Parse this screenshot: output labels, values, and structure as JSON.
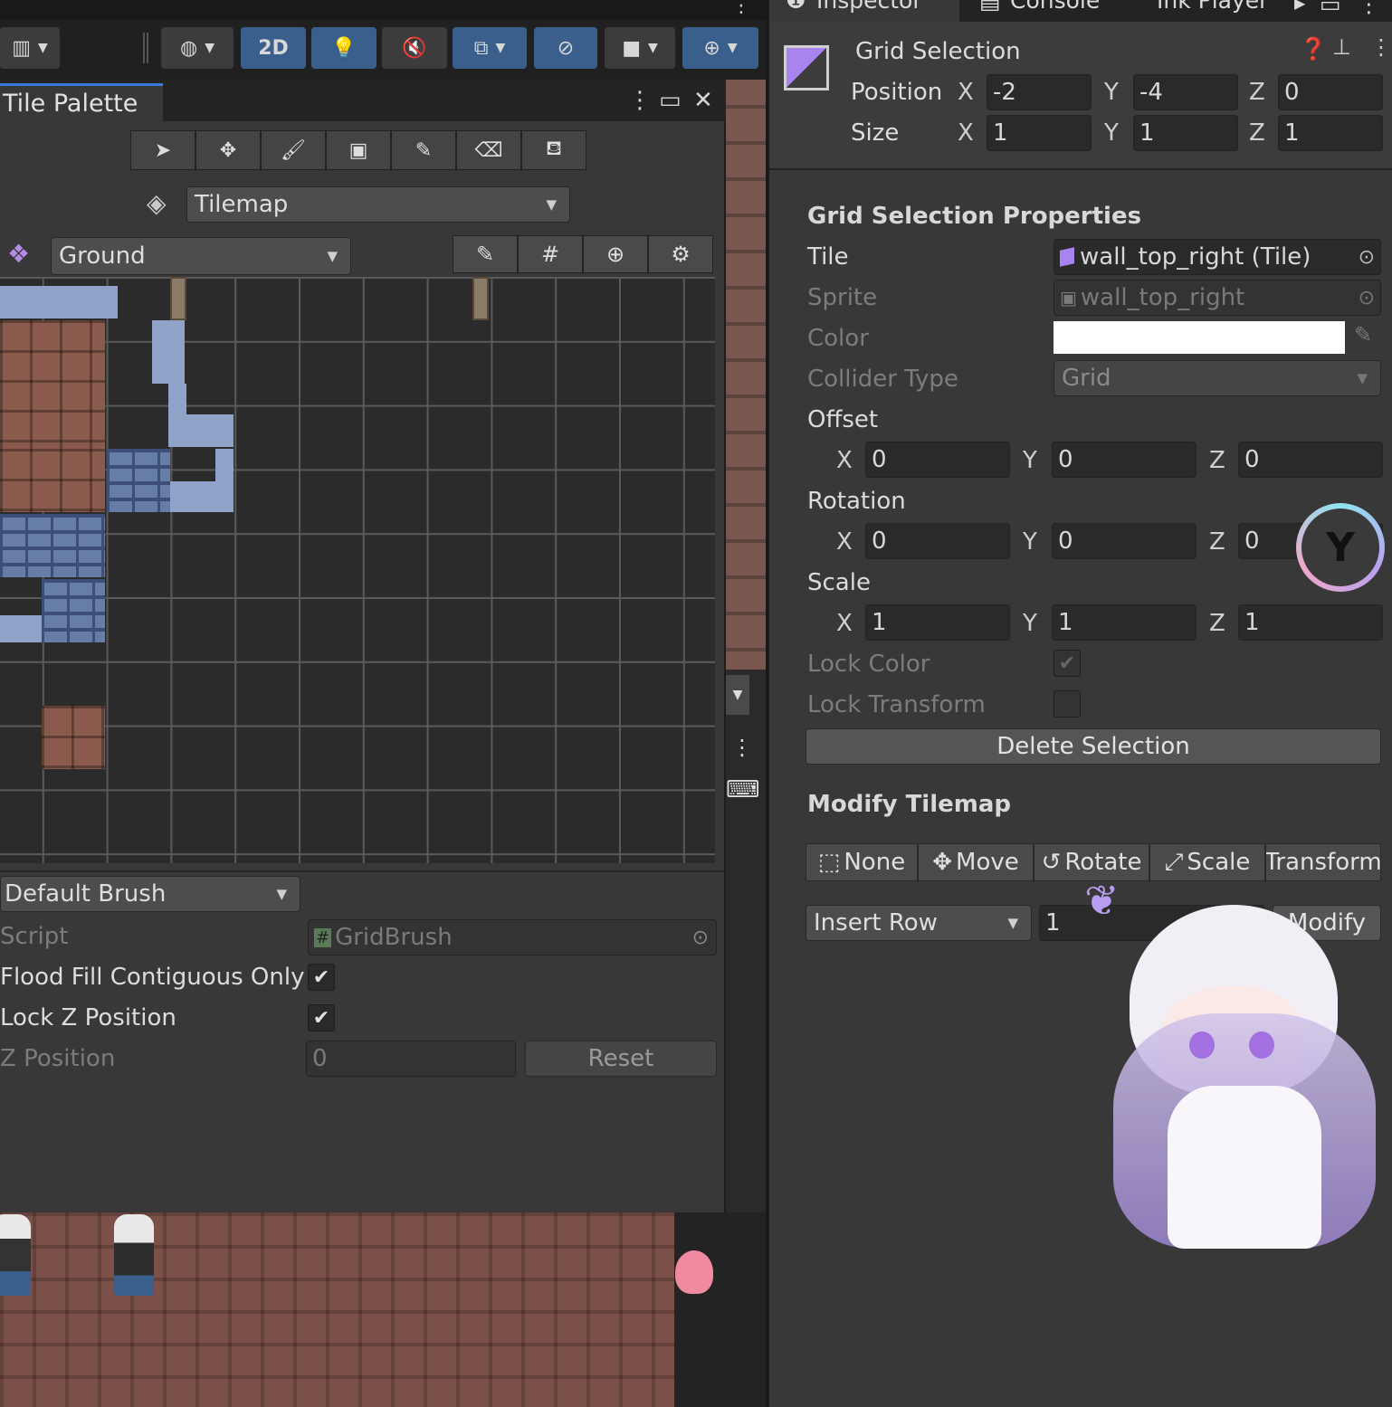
{
  "toolbar": {
    "mode_2d": "2D"
  },
  "palette": {
    "tab_title": "Tile Palette",
    "tilemap_target": "Tilemap",
    "palette_name": "Ground",
    "brush": {
      "selected": "Default Brush",
      "script_label": "Script",
      "script_value": "GridBrush",
      "flood_fill_label": "Flood Fill Contiguous Only",
      "flood_fill_checked": true,
      "lock_z_label": "Lock Z Position",
      "lock_z_checked": true,
      "z_position_label": "Z Position",
      "z_position_value": "0",
      "reset_label": "Reset"
    }
  },
  "inspector": {
    "tabs": [
      "Inspector",
      "Console",
      "Ink Player"
    ],
    "header": {
      "title": "Grid Selection",
      "position_label": "Position",
      "size_label": "Size",
      "position": {
        "x": "-2",
        "y": "-4",
        "z": "0"
      },
      "size": {
        "x": "1",
        "y": "1",
        "z": "1"
      }
    },
    "properties_title": "Grid Selection Properties",
    "tile_label": "Tile",
    "tile_value": "wall_top_right (Tile)",
    "sprite_label": "Sprite",
    "sprite_value": "wall_top_right",
    "color_label": "Color",
    "color_value": "#ffffff",
    "collider_label": "Collider Type",
    "collider_value": "Grid",
    "offset_label": "Offset",
    "offset": {
      "x": "0",
      "y": "0",
      "z": "0"
    },
    "rotation_label": "Rotation",
    "rotation": {
      "x": "0",
      "y": "0",
      "z": "0"
    },
    "scale_label": "Scale",
    "scale": {
      "x": "1",
      "y": "1",
      "z": "1"
    },
    "lock_color_label": "Lock Color",
    "lock_color_checked": true,
    "lock_transform_label": "Lock Transform",
    "lock_transform_checked": false,
    "delete_selection_label": "Delete Selection",
    "modify_title": "Modify Tilemap",
    "modify_modes": [
      "None",
      "Move",
      "Rotate",
      "Scale",
      "Transform"
    ],
    "insert_row_label": "Insert Row",
    "insert_count": "1",
    "modify_button": "Modify"
  },
  "axes": {
    "x": "X",
    "y": "Y",
    "z": "Z"
  }
}
